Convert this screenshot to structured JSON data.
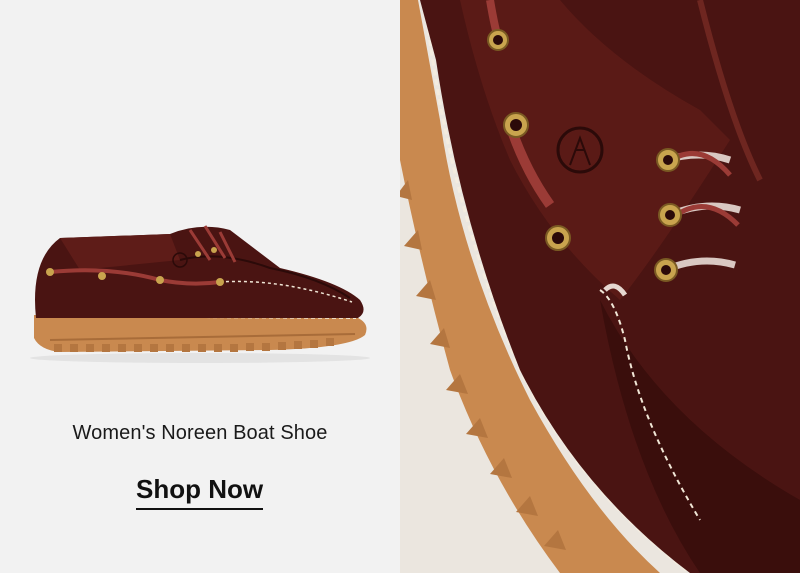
{
  "product": {
    "title": "Women's Noreen Boat Shoe",
    "cta_label": "Shop Now"
  },
  "images": {
    "product": "boat-shoe-side-view",
    "detail": "boat-shoe-closeup-lacing"
  },
  "colors": {
    "left_background": "#f2f2f2",
    "leather": "#4a1412",
    "sole": "#c9894f",
    "lace": "#9b3b36",
    "text": "#1a1a1a"
  }
}
